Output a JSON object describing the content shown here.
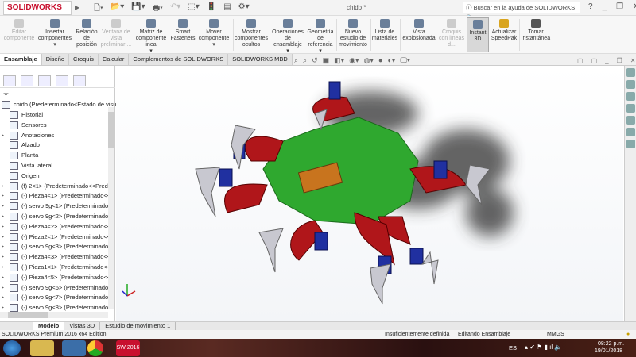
{
  "app": {
    "logo": "SOLIDWORKS",
    "document_title": "chido *",
    "search_placeholder": "Buscar en la ayuda de SOLIDWORKS",
    "help": "?",
    "window_controls": [
      "_",
      "❐",
      "✕"
    ]
  },
  "ribbon": [
    {
      "label": "Editar componente",
      "disabled": true
    },
    {
      "label": "Insertar componentes"
    },
    {
      "label": "Relación de posición"
    },
    {
      "label": "Ventana de vista preliminar ...",
      "disabled": true
    },
    {
      "label": "Matriz de componente lineal"
    },
    {
      "label": "Smart Fasteners"
    },
    {
      "label": "Mover componente"
    },
    {
      "label": "Mostrar componentes ocultos"
    },
    {
      "label": "Operaciones de ensamblaje"
    },
    {
      "label": "Geometría de referencia"
    },
    {
      "label": "Nuevo estudio de movimiento"
    },
    {
      "label": "Lista de materiales"
    },
    {
      "label": "Vista explosionada"
    },
    {
      "label": "Croquis con líneas d...",
      "disabled": true
    },
    {
      "label": "Instant 3D",
      "active": true
    },
    {
      "label": "Actualizar SpeedPak"
    },
    {
      "label": "Tomar instantánea"
    }
  ],
  "tabs": [
    "Ensamblaje",
    "Diseño",
    "Croquis",
    "Calcular",
    "Complementos de SOLIDWORKS",
    "SOLIDWORKS MBD"
  ],
  "tree": {
    "root": "chido  (Predeterminado<Estado de visu",
    "items": [
      "Historial",
      "Sensores",
      "Anotaciones",
      "Alzado",
      "Planta",
      "Vista lateral",
      "Origen",
      "(f) 2<1> (Predeterminado<<Prede",
      "(-) Pieza4<1> (Predeterminado<<P",
      "(-) servo 9g<1> (Predeterminado<",
      "(-) servo 9g<2> (Predeterminado<",
      "(-) Pieza4<2> (Predeterminado<<P",
      "(-) Pieza2<1> (Predeterminado<<P",
      "(-) servo 9g<3> (Predeterminado<",
      "(-) Pieza4<3> (Predeterminado<<P",
      "(-) Pieza1<1> (Predeterminado<<P",
      "(-) Pieza4<5> (Predeterminado<<P",
      "(-) servo 9g<6> (Predeterminado<",
      "(-) servo 9g<7> (Predeterminado<",
      "(-) servo 9g<8> (Predeterminado<"
    ]
  },
  "bottom_tabs": [
    "Modelo",
    "Vistas 3D",
    "Estudio de movimiento 1"
  ],
  "status": {
    "edition": "SOLIDWORKS Premium 2016 x64 Edition",
    "definition": "Insuficientemente definida",
    "mode": "Editando Ensamblaje",
    "units": "MMGS"
  },
  "taskbar": {
    "lang": "ES",
    "time": "08:22 p.m.",
    "date": "19/01/2018",
    "sw_badge": "SW 2016"
  },
  "colors": {
    "body": "#2fa82f",
    "legs": "#b0161a",
    "servo": "#2030a0",
    "feet": "#c8c8d0",
    "sensor": "#c8741e"
  }
}
